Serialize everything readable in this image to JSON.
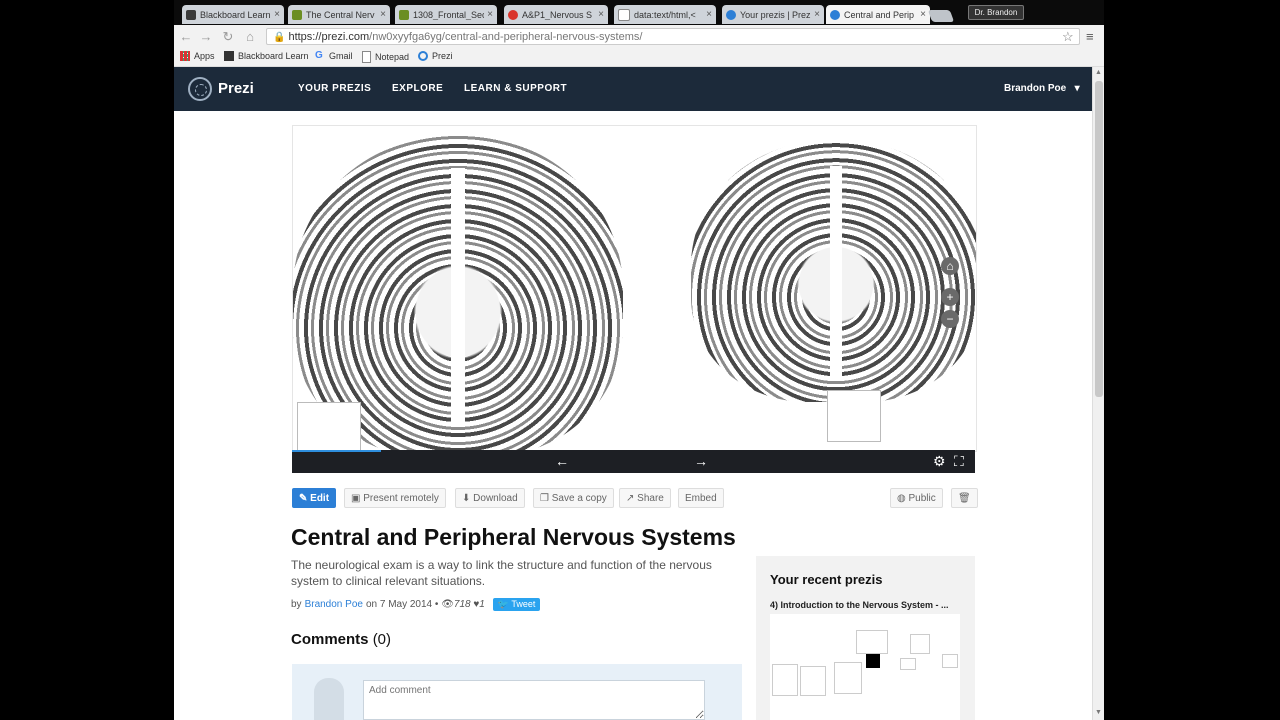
{
  "browser": {
    "tabs": [
      {
        "title": "Blackboard Learn",
        "favicon_color": "#3b3b3b"
      },
      {
        "title": "The Central Nerv",
        "favicon_color": "#6b8e23"
      },
      {
        "title": "1308_Frontal_Sec",
        "favicon_color": "#6b8e23"
      },
      {
        "title": "A&P1_Nervous S",
        "favicon_color": "#d9342b"
      },
      {
        "title": "data:text/html,<",
        "favicon_color": "#888888"
      },
      {
        "title": "Your prezis | Prez",
        "favicon_color": "#2c7fd6"
      },
      {
        "title": "Central and Perip",
        "favicon_color": "#2c7fd6",
        "active": true
      }
    ],
    "profile_label": "Dr. Brandon",
    "url_host": "https://prezi.com",
    "url_path": "/nw0xyyfga6yg/central-and-peripheral-nervous-systems/",
    "bookmarks": [
      {
        "label": "Apps",
        "icon": "apps-grid-icon"
      },
      {
        "label": "Blackboard Learn",
        "icon": "blackboard-icon"
      },
      {
        "label": "Gmail",
        "icon": "google-icon"
      },
      {
        "label": "Notepad",
        "icon": "page-icon"
      },
      {
        "label": "Prezi",
        "icon": "prezi-icon"
      }
    ]
  },
  "prezi_nav": {
    "logo": "Prezi",
    "links": [
      "YOUR PREZIS",
      "EXPLORE",
      "LEARN & SUPPORT"
    ],
    "user": "Brandon Poe",
    "user_caret": "▾"
  },
  "viewer": {
    "progress_fraction": 0.13,
    "controls": {
      "home": "⌂",
      "zoom_in": "+",
      "zoom_out": "−"
    },
    "prev": "←",
    "next": "→",
    "settings": "⚙",
    "fullscreen": "⛶"
  },
  "actions": {
    "edit": "✎ Edit",
    "present_remotely": "Present remotely",
    "download": "Download",
    "save_copy": "Save a copy",
    "share": "Share",
    "embed": "Embed",
    "public": "Public",
    "delete": "🗑"
  },
  "prezi": {
    "title": "Central and Peripheral Nervous Systems",
    "description": "The neurological exam is a way to link the structure and function of the nervous system to clinical relevant situations.",
    "by": "by",
    "author": "Brandon Poe",
    "date": "on 7 May 2014",
    "views": "718",
    "likes": "1",
    "tweet": "Tweet"
  },
  "comments": {
    "label": "Comments",
    "count": "(0)",
    "placeholder": "Add comment"
  },
  "recent": {
    "heading": "Your recent prezis",
    "item": "4) Introduction to the Nervous System - ..."
  }
}
